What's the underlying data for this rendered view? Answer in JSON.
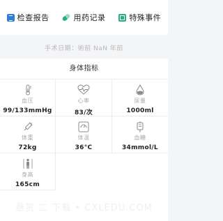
{
  "tabs": [
    {
      "label": "检查报告",
      "icon": "report-icon",
      "color": "#2f7ed8"
    },
    {
      "label": "用药记录",
      "icon": "pill-icon",
      "color": "#26b07e"
    },
    {
      "label": "特殊事件",
      "icon": "special-event-icon",
      "color": "#26b07e"
    }
  ],
  "surgery": {
    "text": "手术日期：術前 NaN 年前"
  },
  "vitals": {
    "title": "身体指标",
    "items": [
      {
        "label": "血压",
        "value": "99/133mmHg",
        "icon": "thermometer-icon"
      },
      {
        "label": "心率",
        "value": "83/次",
        "icon": "heart-rate-icon"
      },
      {
        "label": "尿量",
        "value": "1000ml",
        "icon": "drop-icon"
      },
      {
        "label": "体重",
        "value": "72kg",
        "icon": "syringe-icon"
      },
      {
        "label": "体温",
        "value": "36°C",
        "icon": "scale-icon"
      },
      {
        "label": "血糖",
        "value": "34mmol/L",
        "icon": "iv-bag-icon"
      },
      {
        "label": "身高",
        "value": "165cm",
        "icon": "person-height-icon"
      }
    ]
  },
  "watermark": "悬赏 二 下载 • CXLEDU.COM"
}
